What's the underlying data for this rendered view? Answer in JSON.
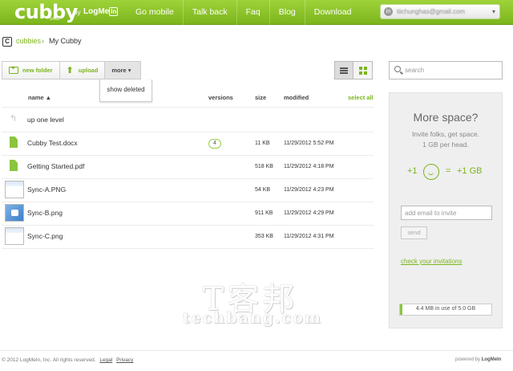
{
  "brand": {
    "logo": "cubby",
    "beta": "beta",
    "by": "by",
    "logmein": "LogMe",
    "logmein_in": "In"
  },
  "nav": [
    "Go mobile",
    "Talk back",
    "Faq",
    "Blog",
    "Download"
  ],
  "account": {
    "email": "tiichunghas@gmail.com"
  },
  "breadcrumb": {
    "icon": "C",
    "root": "cubbies",
    "sep": "›",
    "current": "My Cubby"
  },
  "toolbar": {
    "new_folder": "new folder",
    "upload": "upload",
    "more": "more ▾",
    "show_deleted": "show deleted"
  },
  "table": {
    "headers": {
      "name": "name ▲",
      "versions": "versions",
      "size": "size",
      "modified": "modified",
      "select_all": "select all"
    },
    "up": "up one level",
    "rows": [
      {
        "name": "Cubby Test.docx",
        "version": "4",
        "size": "11 KB",
        "modified": "11/29/2012 5:52 PM",
        "icon": "document-icon"
      },
      {
        "name": "Getting Started.pdf",
        "version": "",
        "size": "518 KB",
        "modified": "11/29/2012 4:18 PM",
        "icon": "document-icon"
      },
      {
        "name": "Sync-A.PNG",
        "version": "",
        "size": "54 KB",
        "modified": "11/29/2012 4:23 PM",
        "icon": "image-thumbnail"
      },
      {
        "name": "Sync-B.png",
        "version": "",
        "size": "911 KB",
        "modified": "11/29/2012 4:29 PM",
        "icon": "image-thumbnail"
      },
      {
        "name": "Sync-C.png",
        "version": "",
        "size": "353 KB",
        "modified": "11/29/2012 4:31 PM",
        "icon": "image-thumbnail"
      }
    ]
  },
  "search": {
    "placeholder": "search"
  },
  "sidebar": {
    "title": "More space?",
    "line1": "Invite folks, get space.",
    "line2": "1 GB per head.",
    "plus_one": "+1",
    "equals": "=",
    "gb": "+1 GB",
    "invite_placeholder": "add email to invite",
    "send": "send",
    "check_invitations": "check your invitations",
    "usage": "4.4 MB in use of 5.0 GB",
    "usage_fraction": 0.0009
  },
  "watermark": {
    "cn": "T客邦",
    "en": "techbang.com"
  },
  "footer": {
    "copyright": "© 2012 LogMeIn, Inc. All rights reserved.",
    "legal": "Legal",
    "privacy": "Privacy",
    "powered": "powered by",
    "powered_brand": "LogMeIn"
  },
  "colors": {
    "accent": "#7bb51c",
    "file_icon": "#8bc53f"
  }
}
